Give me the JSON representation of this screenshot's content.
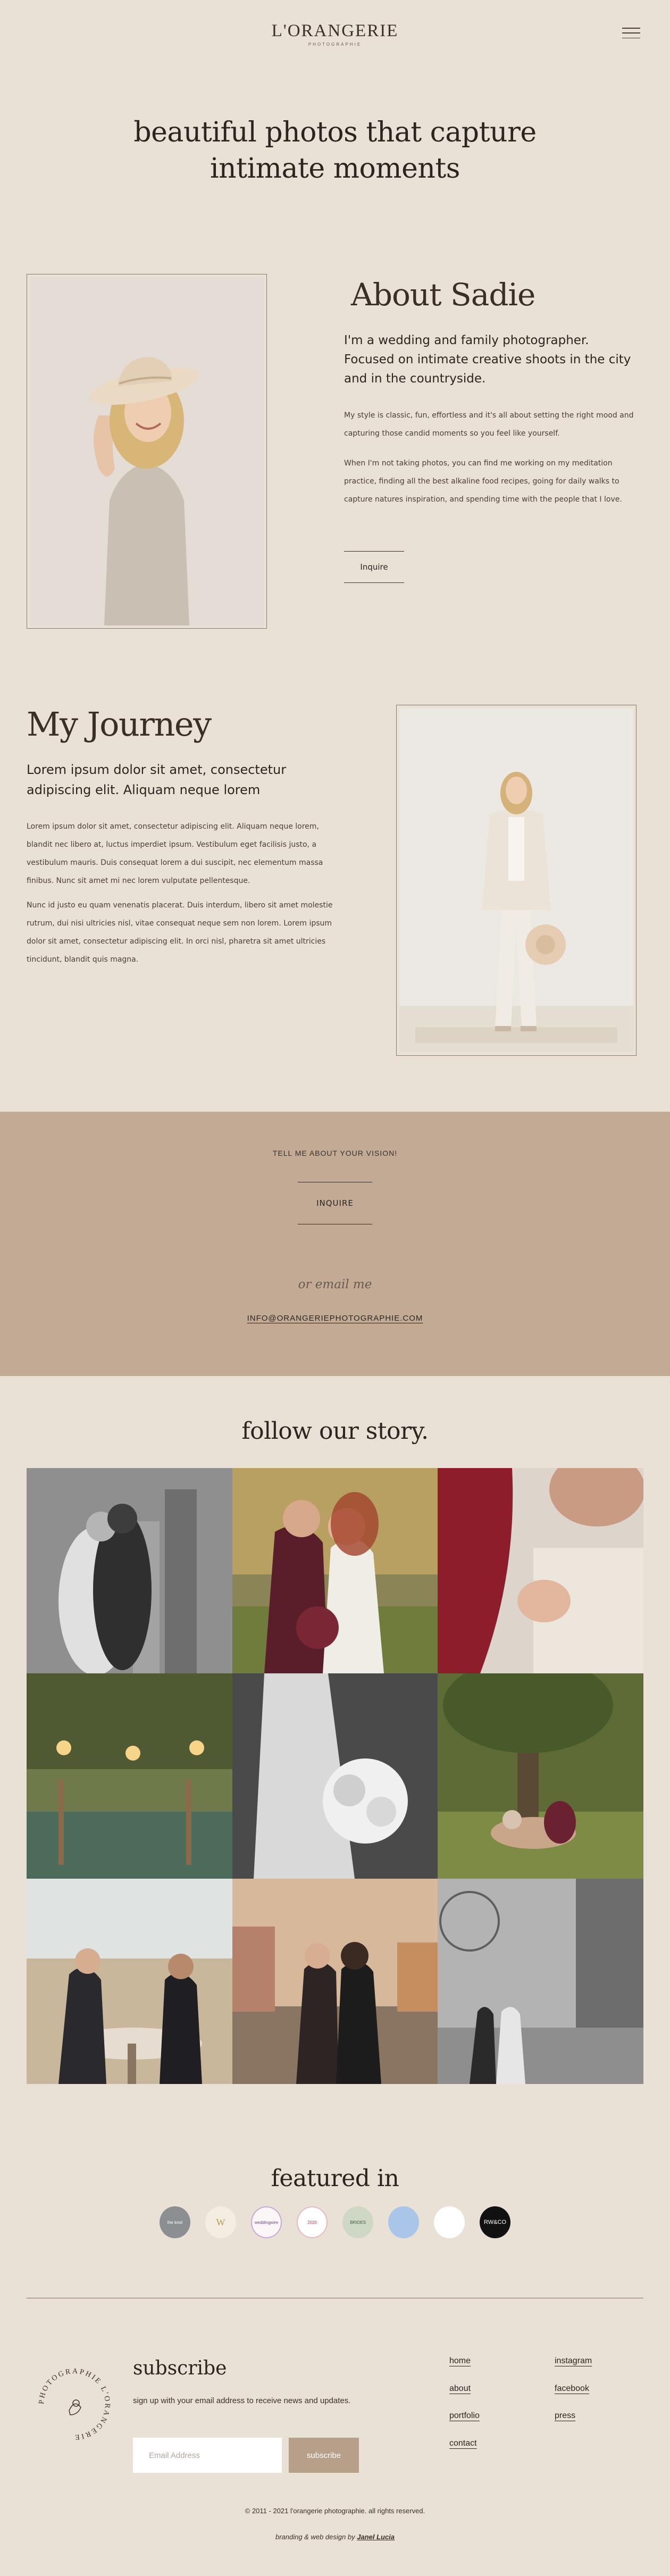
{
  "header": {
    "logo_main": "L'ORANGERIE",
    "logo_sub": "PHOTOGRAPHIE",
    "menu_icon": "hamburger-menu-icon"
  },
  "hero": {
    "line1": "beautiful photos that capture",
    "line2": "intimate moments"
  },
  "about": {
    "title": "About Sadie",
    "lead": "I'm a wedding and family photographer. Focused on intimate creative shoots in the city and in the countryside.",
    "p1": "My style is classic, fun, effortless and it's all about setting the right mood and capturing those candid moments so you feel like yourself.",
    "p2": "When I'm not taking photos, you can find me working on my meditation practice, finding all the best alkaline food recipes, going for daily walks to capture natures inspiration, and spending time with the people that I love.",
    "button": "Inquire"
  },
  "journey": {
    "title": "My Journey",
    "lead": "Lorem ipsum dolor sit amet, consectetur adipiscing elit. Aliquam neque lorem",
    "p1": "Lorem ipsum dolor sit amet, consectetur adipiscing elit. Aliquam neque lorem, blandit nec libero at, luctus imperdiet ipsum. Vestibulum eget facilisis justo, a vestibulum mauris. Duis consequat lorem a dui suscipit, nec elementum massa finibus. Nunc sit amet mi nec lorem vulputate pellentesque.",
    "p2": "Nunc id justo eu quam venenatis placerat. Duis interdum, libero sit amet molestie rutrum, dui nisi ultricies nisl, vitae consequat neque sem non lorem. Lorem ipsum dolor sit amet, consectetur adipiscing elit. In orci nisl, pharetra sit amet ultricies tincidunt, blandit quis magna."
  },
  "cta": {
    "label": "TELL ME ABOUT YOUR VISION!",
    "button": "INQUIRE",
    "or": "or email me",
    "email": "INFO@ORANGERIEPHOTOGRAPHIE.COM"
  },
  "follow": {
    "title": "follow our story."
  },
  "featured": {
    "title": "featured in",
    "badges": [
      "the knot",
      "W",
      "weddingwire",
      "2020",
      "BRIDES",
      "",
      "",
      "RW&CO"
    ]
  },
  "footer": {
    "seal_text": "PHOTOGRAPHIE L'ORANGERIE",
    "subscribe_title": "subscribe",
    "subscribe_text": "sign up with your email address to receive news and updates.",
    "email_placeholder": "Email Address",
    "subscribe_button": "subscribe",
    "links": {
      "home": "home",
      "about": "about",
      "portfolio": "portfolio",
      "contact": "contact",
      "instagram": "instagram",
      "facebook": "facebook",
      "press": "press"
    },
    "copyright": "© 2011 - 2021 l'orangerie photographie. all rights reserved.",
    "credit_prefix": "branding & web design by",
    "credit_name": "Janel Lucia"
  },
  "colors": {
    "background": "#e9e0d6",
    "cta_band": "#c2aa95",
    "subscribe_button": "#b89f8a",
    "text": "#2b2520"
  }
}
